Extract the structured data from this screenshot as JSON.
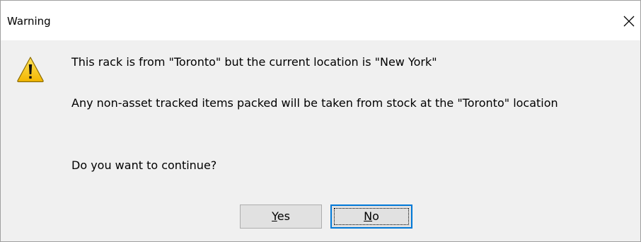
{
  "window": {
    "title": "Warning",
    "close_icon": "close-icon"
  },
  "dialog": {
    "icon": "warning-icon",
    "message_line1": "This rack is from \"Toronto\" but the current location is \"New York\"",
    "message_line2": "Any non-asset tracked items packed will be taken from stock at the \"Toronto\" location",
    "message_line3": "Do you want to continue?"
  },
  "buttons": {
    "yes": {
      "accel": "Y",
      "rest": "es"
    },
    "no": {
      "accel": "N",
      "rest": "o",
      "focused": true
    }
  },
  "colors": {
    "focus_border": "#0078d7",
    "button_bg": "#e1e1e1",
    "dialog_bg": "#f0f0f0",
    "titlebar_bg": "#ffffff",
    "warning_yellow": "#f7c600"
  }
}
